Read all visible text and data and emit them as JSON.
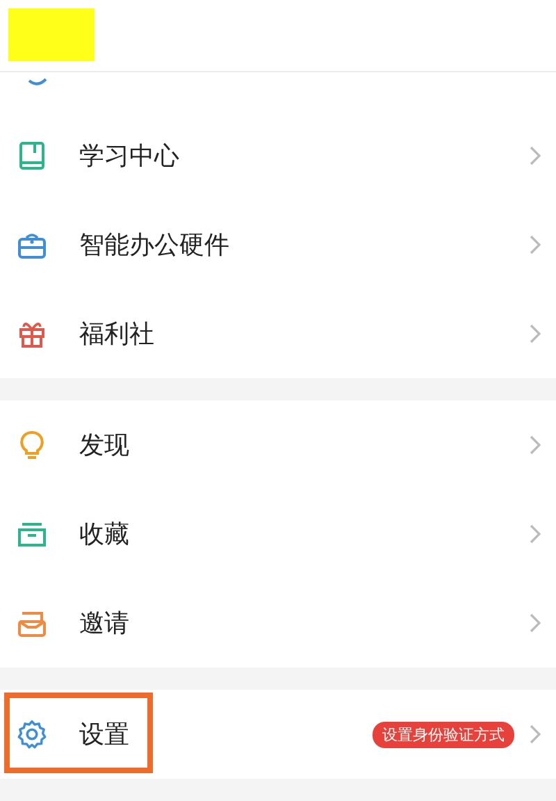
{
  "groups": [
    {
      "items": [
        {
          "label": "学习中心"
        },
        {
          "label": "智能办公硬件"
        },
        {
          "label": "福利社"
        }
      ]
    },
    {
      "items": [
        {
          "label": "发现"
        },
        {
          "label": "收藏"
        },
        {
          "label": "邀请"
        }
      ]
    },
    {
      "items": [
        {
          "label": "设置",
          "badge": "设置身份验证方式",
          "highlighted": true
        }
      ]
    }
  ]
}
